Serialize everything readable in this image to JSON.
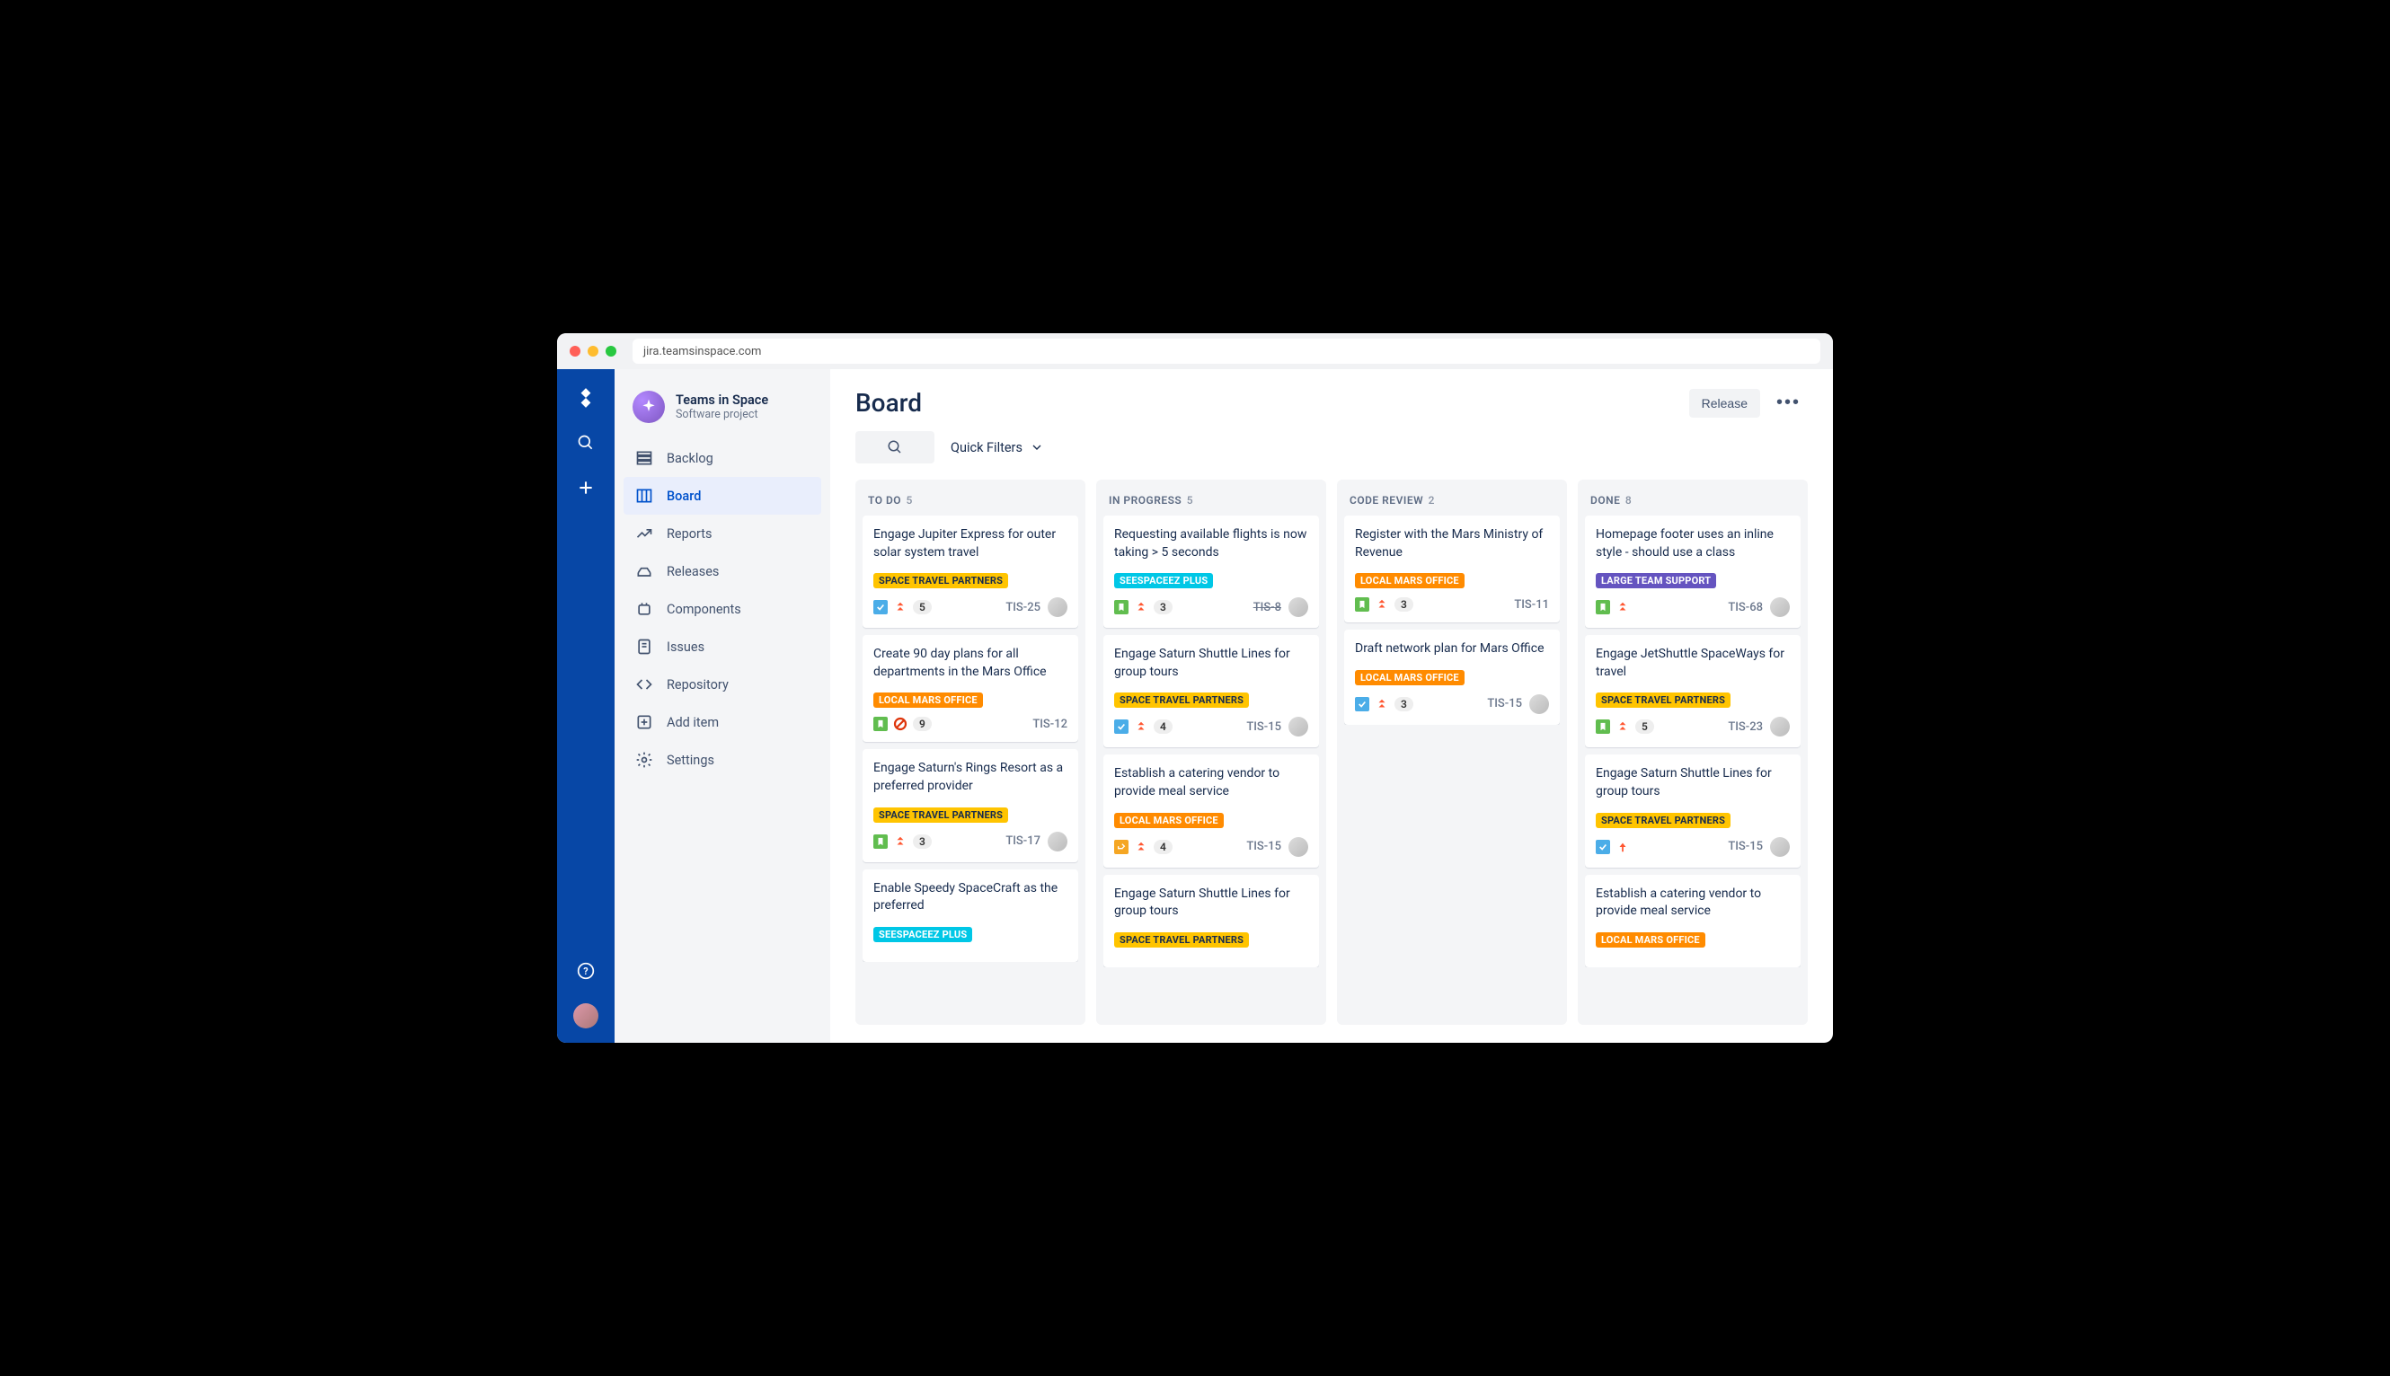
{
  "browser": {
    "url": "jira.teamsinspace.com"
  },
  "project": {
    "name": "Teams in Space",
    "type": "Software project"
  },
  "nav": {
    "backlog": "Backlog",
    "board": "Board",
    "reports": "Reports",
    "releases": "Releases",
    "components": "Components",
    "issues": "Issues",
    "repository": "Repository",
    "additem": "Add item",
    "settings": "Settings"
  },
  "header": {
    "title": "Board",
    "release": "Release",
    "filters": "Quick Filters"
  },
  "labels": {
    "space_travel": {
      "text": "SPACE TRAVEL PARTNERS",
      "bg": "#ffc400",
      "fg": "#172b4d"
    },
    "seespaceez": {
      "text": "SEESPACEEZ PLUS",
      "bg": "#00c7e6",
      "fg": "#fff"
    },
    "local_mars": {
      "text": "LOCAL MARS OFFICE",
      "bg": "#ff8b00",
      "fg": "#fff"
    },
    "large_team": {
      "text": "LARGE TEAM SUPPORT",
      "bg": "#6554c0",
      "fg": "#fff"
    }
  },
  "columns": [
    {
      "title": "TO DO",
      "count": "5",
      "cards": [
        {
          "title": "Engage Jupiter Express for outer solar system travel",
          "label": "space_travel",
          "type": "task",
          "priority": "high",
          "sp": "5",
          "key": "TIS-25",
          "assignee": true
        },
        {
          "title": "Create 90 day plans for all departments in the Mars Office",
          "label": "local_mars",
          "type": "story",
          "priority": "blocked",
          "sp": "9",
          "key": "TIS-12",
          "assignee": false
        },
        {
          "title": "Engage Saturn's Rings Resort as a preferred provider",
          "label": "space_travel",
          "type": "story",
          "priority": "high",
          "sp": "3",
          "key": "TIS-17",
          "assignee": true
        },
        {
          "title": "Enable Speedy SpaceCraft as the preferred",
          "label": "seespaceez",
          "type": "",
          "priority": "",
          "sp": "",
          "key": "",
          "assignee": false,
          "partial": true
        }
      ]
    },
    {
      "title": "IN PROGRESS",
      "count": "5",
      "cards": [
        {
          "title": "Requesting available flights is now taking > 5 seconds",
          "label": "seespaceez",
          "type": "story",
          "priority": "high",
          "sp": "3",
          "key": "TIS-8",
          "strike": true,
          "assignee": true
        },
        {
          "title": "Engage Saturn Shuttle Lines for group tours",
          "label": "space_travel",
          "type": "task",
          "priority": "high",
          "sp": "4",
          "key": "TIS-15",
          "assignee": true
        },
        {
          "title": "Establish a catering vendor to provide meal service",
          "label": "local_mars",
          "type": "subtask",
          "priority": "high",
          "sp": "4",
          "key": "TIS-15",
          "assignee": true
        },
        {
          "title": "Engage Saturn Shuttle Lines for group tours",
          "label": "space_travel",
          "type": "",
          "priority": "",
          "sp": "",
          "key": "",
          "assignee": false,
          "partial": true
        }
      ]
    },
    {
      "title": "CODE REVIEW",
      "count": "2",
      "cards": [
        {
          "title": "Register with the Mars Ministry of Revenue",
          "label": "local_mars",
          "type": "story",
          "priority": "high",
          "sp": "3",
          "key": "TIS-11",
          "assignee": false
        },
        {
          "title": "Draft network plan for Mars Office",
          "label": "local_mars",
          "type": "task",
          "priority": "high",
          "sp": "3",
          "key": "TIS-15",
          "assignee": true
        }
      ]
    },
    {
      "title": "DONE",
      "count": "8",
      "cards": [
        {
          "title": "Homepage footer uses an inline style - should use a class",
          "label": "large_team",
          "type": "story",
          "priority": "high",
          "sp": "",
          "key": "TIS-68",
          "assignee": true
        },
        {
          "title": "Engage JetShuttle SpaceWays for travel",
          "label": "space_travel",
          "type": "story",
          "priority": "high",
          "sp": "5",
          "key": "TIS-23",
          "assignee": true
        },
        {
          "title": "Engage Saturn Shuttle Lines for group tours",
          "label": "space_travel",
          "type": "task",
          "priority": "medium",
          "sp": "",
          "key": "TIS-15",
          "assignee": true
        },
        {
          "title": "Establish a catering vendor to provide meal service",
          "label": "local_mars",
          "type": "",
          "priority": "",
          "sp": "",
          "key": "",
          "assignee": false,
          "partial": true
        }
      ]
    }
  ]
}
